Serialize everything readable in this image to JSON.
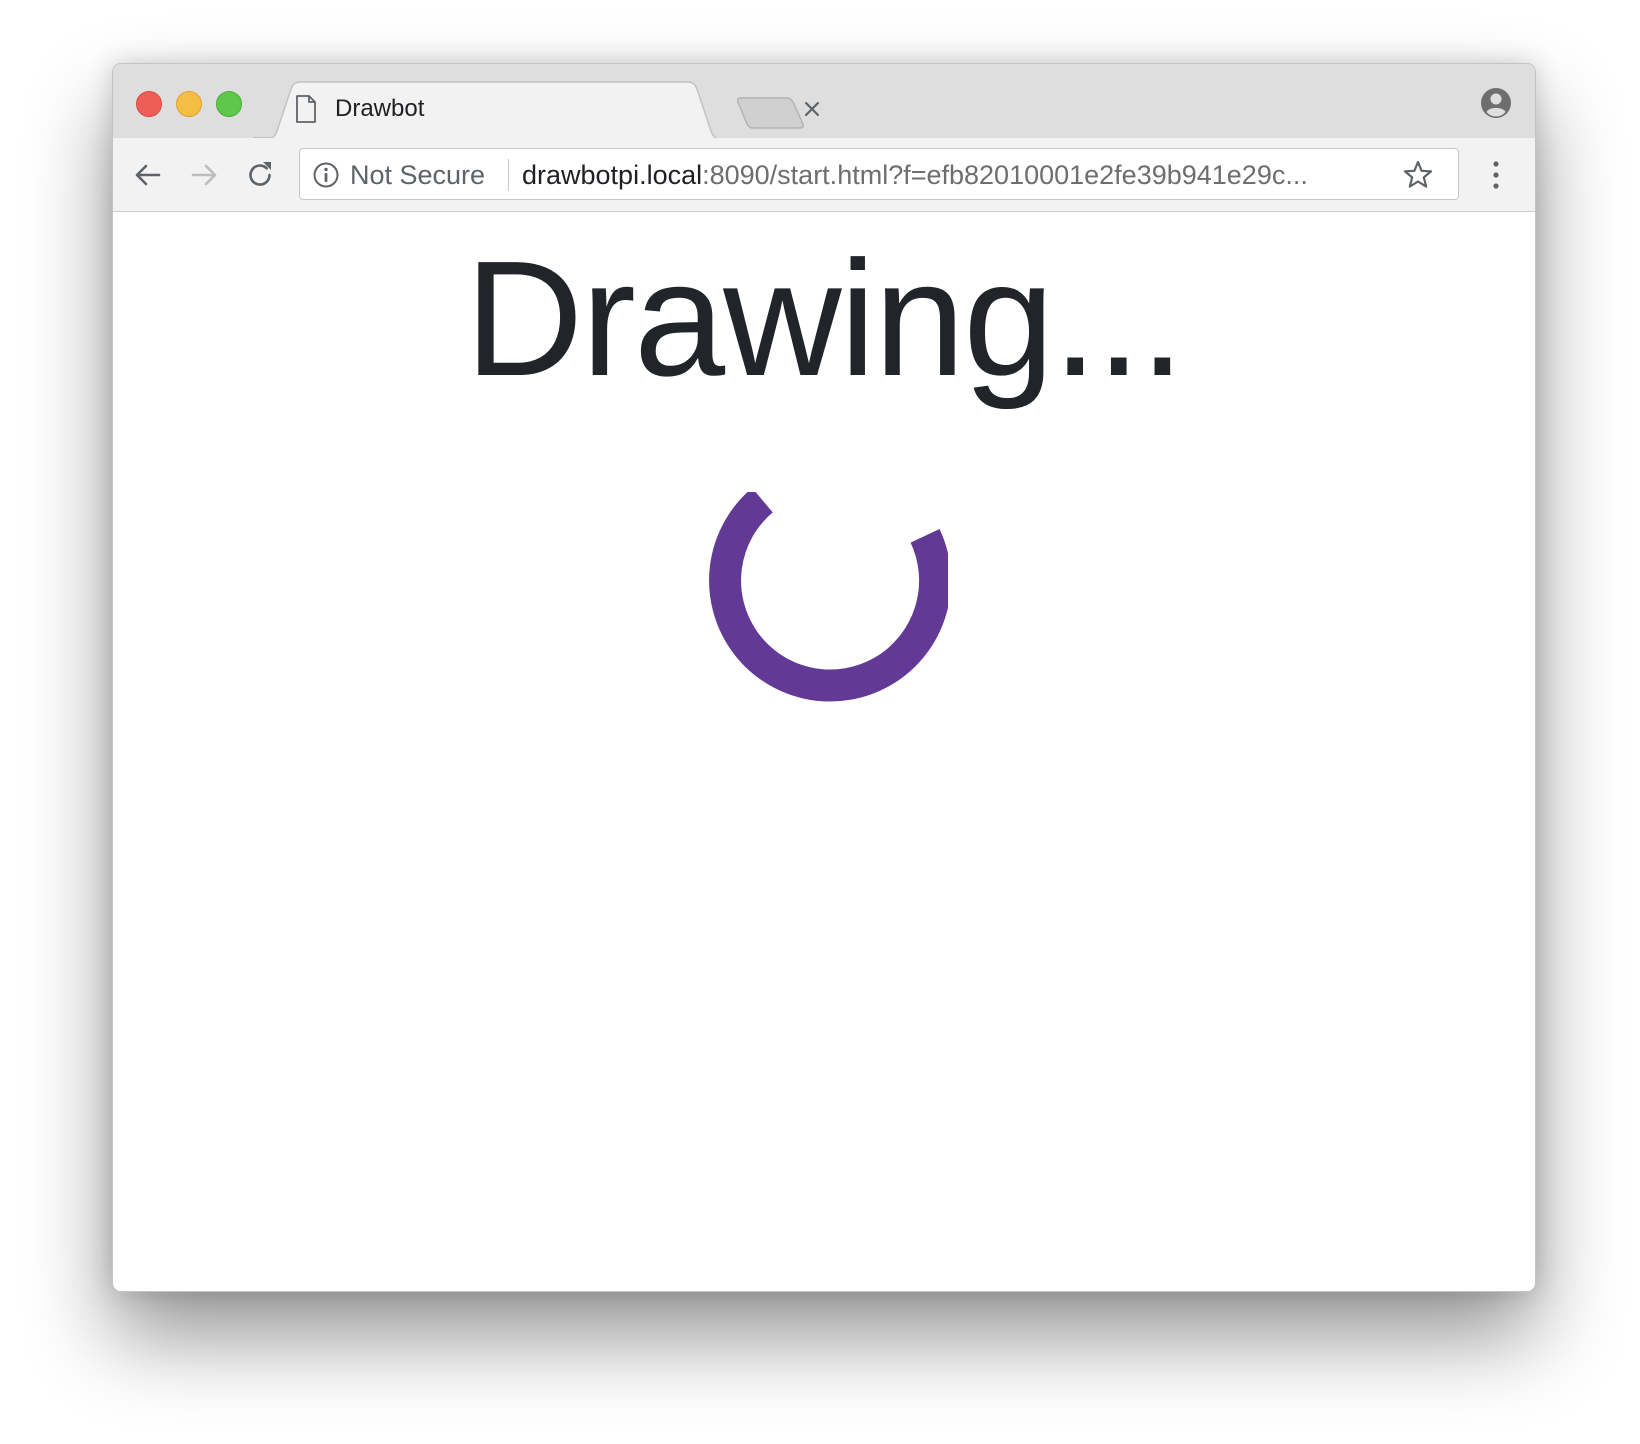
{
  "browser": {
    "tab": {
      "title": "Drawbot"
    },
    "address_bar": {
      "security_label": "Not Secure",
      "url_host": "drawbotpi.local",
      "url_rest": ":8090/start.html?f=efb82010001e2fe39b941e29c..."
    }
  },
  "page": {
    "heading": "Drawing...",
    "spinner_color": "#623a96"
  },
  "icons": {
    "tab": "page-icon",
    "tab_close": "close-icon",
    "new_tab": "new-tab-icon",
    "profile": "profile-icon",
    "back": "arrow-left-icon",
    "forward": "arrow-right-icon",
    "reload": "reload-icon",
    "security": "info-icon",
    "bookmark": "star-icon",
    "menu": "menu-dots-icon",
    "loading": "spinner-icon"
  }
}
